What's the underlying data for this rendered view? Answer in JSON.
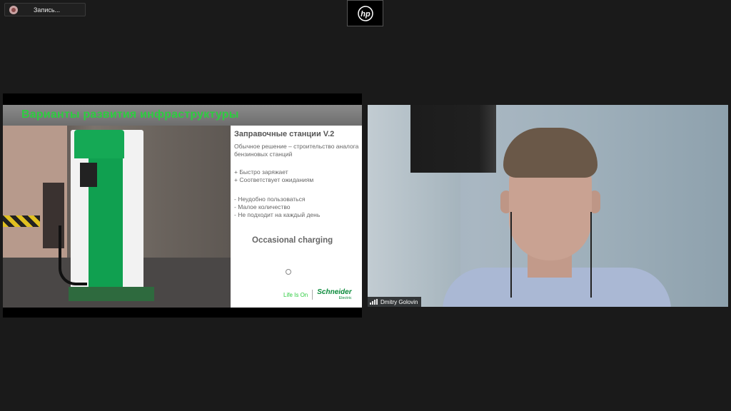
{
  "recording": {
    "label": "Запись..."
  },
  "hp_logo": {
    "text": "hp",
    "icon": "hp-logo-icon"
  },
  "slide": {
    "title": "Варианты развития инфраструктуры",
    "station_title": "Заправочные станции V.2",
    "description": "Обычное решение – строительство аналога бензиновых станций",
    "pros": [
      "+ Быстро заряжает",
      "+ Соответствует ожиданиям"
    ],
    "cons": [
      "- Неудобно пользоваться",
      "- Малое количество",
      "- Не подходит на каждый день"
    ],
    "footer_text": "Occasional charging",
    "life_is_on": "Life Is On",
    "brand": "Schneider",
    "brand_sub": "Electric",
    "photo_icon": "charging-station-photo"
  },
  "video": {
    "participant_name": "Dmitry Golovin",
    "signal_icon": "connection-signal-icon"
  },
  "colors": {
    "background": "#1a1a1a",
    "slide_title_green": "#2ecc40",
    "brand_green": "#0a8a3a"
  }
}
